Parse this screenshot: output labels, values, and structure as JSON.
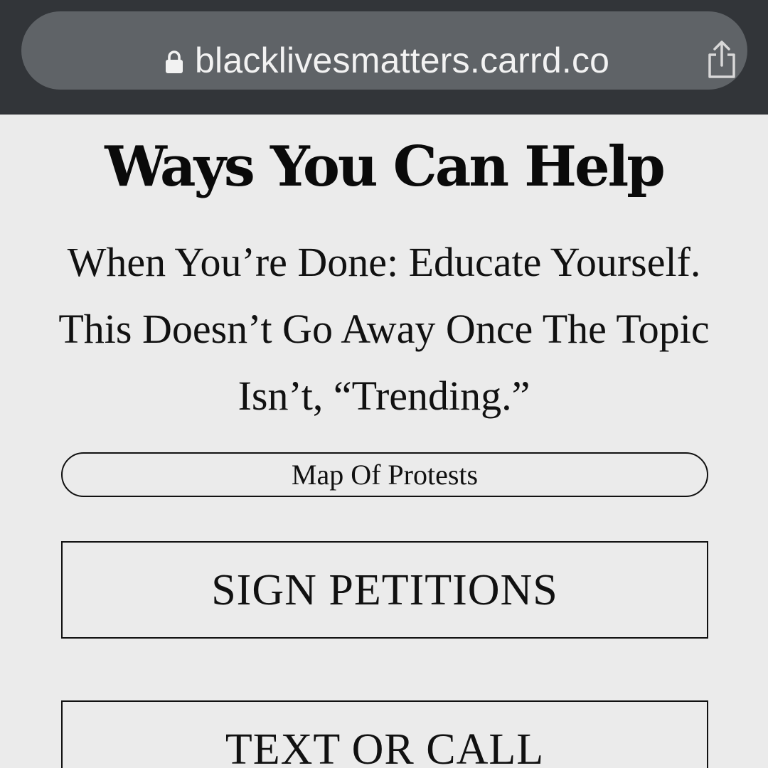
{
  "browser": {
    "url": "blacklivesmatters.carrd.co",
    "icons": {
      "lock": "lock-icon",
      "share": "share-icon"
    }
  },
  "page": {
    "title": "Ways You Can Help",
    "intro": "When You’re Done: Educate Yourself. This Doesn’t Go Away Once The Topic Isn’t, “Trending.”"
  },
  "buttons": {
    "map_of_protests": "Map Of Protests",
    "sign_petitions": "SIGN PETITIONS",
    "text_or_call": "TEXT OR CALL"
  },
  "colors": {
    "browser_bar": "#323539",
    "url_pill": "#5f6367",
    "page_background": "#ebebeb",
    "text": "#0a0a0a"
  }
}
